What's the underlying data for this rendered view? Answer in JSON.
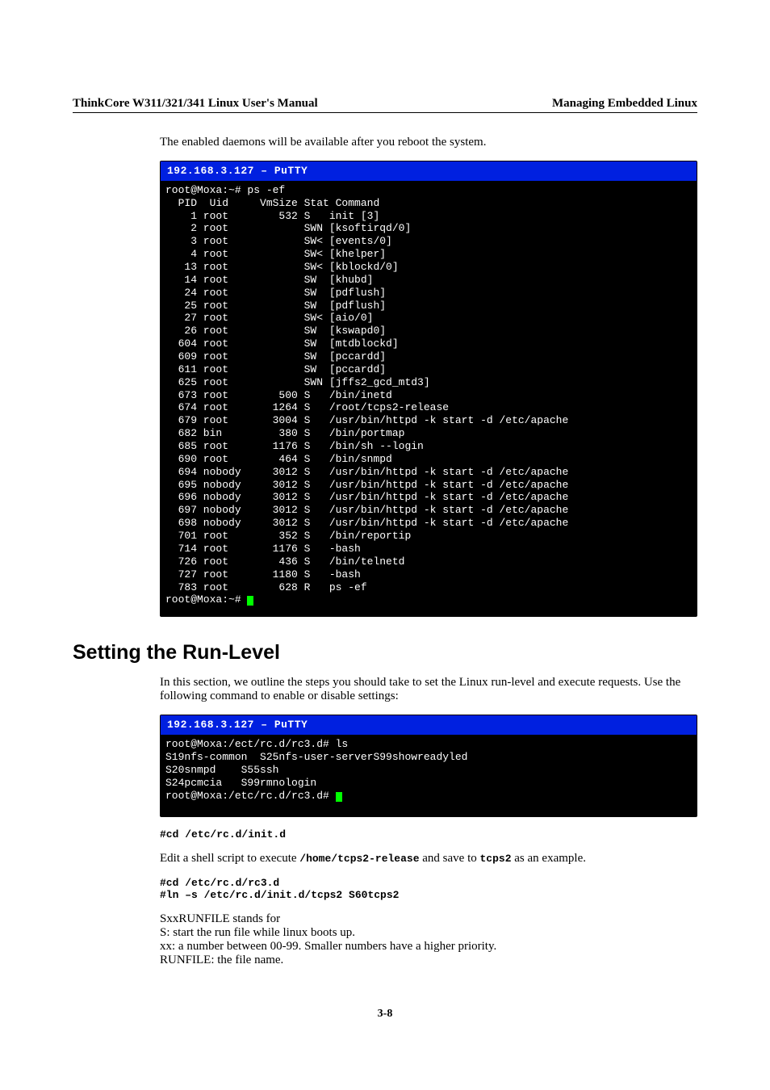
{
  "header": {
    "left": "ThinkCore W311/321/341 Linux User's Manual",
    "right": "Managing Embedded Linux"
  },
  "intro1": "The enabled daemons will be available after you reboot the system.",
  "term1": {
    "title": "  192.168.3.127 – PuTTY",
    "lines": [
      "root@Moxa:~# ps -ef",
      "  PID  Uid     VmSize Stat Command",
      "    1 root        532 S   init [3]",
      "    2 root            SWN [ksoftirqd/0]",
      "    3 root            SW< [events/0]",
      "    4 root            SW< [khelper]",
      "   13 root            SW< [kblockd/0]",
      "   14 root            SW  [khubd]",
      "   24 root            SW  [pdflush]",
      "   25 root            SW  [pdflush]",
      "   27 root            SW< [aio/0]",
      "   26 root            SW  [kswapd0]",
      "  604 root            SW  [mtdblockd]",
      "  609 root            SW  [pccardd]",
      "  611 root            SW  [pccardd]",
      "  625 root            SWN [jffs2_gcd_mtd3]",
      "  673 root        500 S   /bin/inetd",
      "  674 root       1264 S   /root/tcps2-release",
      "  679 root       3004 S   /usr/bin/httpd -k start -d /etc/apache",
      "  682 bin         380 S   /bin/portmap",
      "  685 root       1176 S   /bin/sh --login",
      "  690 root        464 S   /bin/snmpd",
      "  694 nobody     3012 S   /usr/bin/httpd -k start -d /etc/apache",
      "  695 nobody     3012 S   /usr/bin/httpd -k start -d /etc/apache",
      "  696 nobody     3012 S   /usr/bin/httpd -k start -d /etc/apache",
      "  697 nobody     3012 S   /usr/bin/httpd -k start -d /etc/apache",
      "  698 nobody     3012 S   /usr/bin/httpd -k start -d /etc/apache",
      "  701 root        352 S   /bin/reportip",
      "  714 root       1176 S   -bash",
      "  726 root        436 S   /bin/telnetd",
      "  727 root       1180 S   -bash",
      "  783 root        628 R   ps -ef",
      "root@Moxa:~# "
    ]
  },
  "section_title": "Setting the Run-Level",
  "section_intro": "In this section, we outline the steps you should take to set the Linux run-level and execute requests. Use the following command to enable or disable settings:",
  "term2": {
    "title": "  192.168.3.127 – PuTTY",
    "lines": [
      "root@Moxa:/ect/rc.d/rc3.d# ls",
      "S19nfs-common  S25nfs-user-serverS99showreadyled",
      "S20snmpd    S55ssh",
      "S24pcmcia   S99rmnologin",
      "root@Moxa:/etc/rc.d/rc3.d# "
    ]
  },
  "cmd1": "#cd /etc/rc.d/init.d",
  "edit_line_pre": "Edit a shell script to execute ",
  "edit_line_code1": "/home/tcps2-release",
  "edit_line_mid": " and save to ",
  "edit_line_code2": "tcps2",
  "edit_line_post": " as an example.",
  "cmd2a": "#cd /etc/rc.d/rc3.d",
  "cmd2b": "#ln –s /etc/rc.d/init.d/tcps2 S60tcps2",
  "para1": "SxxRUNFILE stands for",
  "para2": "S: start the run file while linux boots up.",
  "para3": "xx: a number between 00-99. Smaller numbers have a higher priority.",
  "para4": "RUNFILE: the file name.",
  "footer": "3-8"
}
